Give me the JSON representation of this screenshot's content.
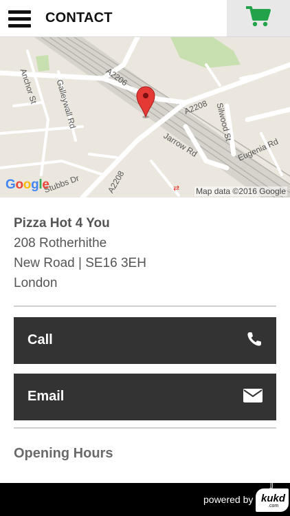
{
  "header": {
    "title": "CONTACT",
    "menu_icon": "hamburger-menu-icon",
    "cart_icon": "shopping-cart-icon",
    "cart_color": "#22a34a"
  },
  "map": {
    "street_labels": [
      "Anchor St",
      "Galleywall Rd",
      "A2206",
      "A2208",
      "Silwood St",
      "Jarrow Rd",
      "Eugenia Rd",
      "A2208",
      "Stubbs Dr"
    ],
    "logo": "Google",
    "attribution": "Map data ©2016 Google",
    "pin_color": "#e53935"
  },
  "address": {
    "name": "Pizza Hot 4 You",
    "line1": "208 Rotherhithe",
    "line2": "New Road | SE16 3EH",
    "line3": "London"
  },
  "actions": {
    "call_label": "Call",
    "call_icon": "phone-icon",
    "email_label": "Email",
    "email_icon": "envelope-icon"
  },
  "opening_hours": {
    "heading": "Opening Hours"
  },
  "footer": {
    "powered_by": "powered by",
    "brand": "kukd",
    "brand_suffix": ".com"
  }
}
